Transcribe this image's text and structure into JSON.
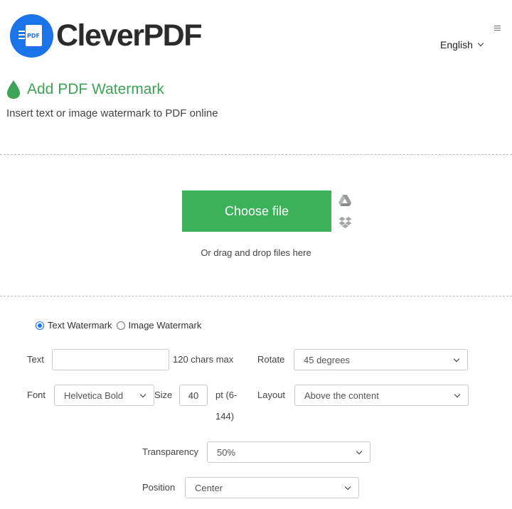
{
  "header": {
    "brand": "CleverPDF",
    "logo_badge": "PDF",
    "language": "English",
    "menu_icon": "hamburger-menu-icon"
  },
  "page": {
    "title": "Add PDF Watermark",
    "subtitle": "Insert text or image watermark to PDF online",
    "title_icon": "water-drop-icon"
  },
  "upload": {
    "choose_label": "Choose file",
    "drag_text": "Or drag and drop files here",
    "icons": [
      "google-drive-icon",
      "dropbox-icon"
    ]
  },
  "options": {
    "watermark_types": [
      {
        "label": "Text Watermark",
        "selected": true
      },
      {
        "label": "Image Watermark",
        "selected": false
      }
    ],
    "text_label": "Text",
    "text_value": "",
    "text_hint": "120 chars max",
    "rotate_label": "Rotate",
    "rotate_value": "45 degrees",
    "font_label": "Font",
    "font_value": "Helvetica Bold",
    "size_label": "Size",
    "size_value": "40",
    "size_hint_1": "pt (6-",
    "size_hint_2": "144)",
    "layout_label": "Layout",
    "layout_value": "Above the content",
    "transparency_label": "Transparency",
    "transparency_value": "50%",
    "position_label": "Position",
    "position_value": "Center"
  },
  "colors": {
    "brand_blue": "#1a73e8",
    "accent_green": "#3cb15a",
    "title_green": "#3da356"
  }
}
